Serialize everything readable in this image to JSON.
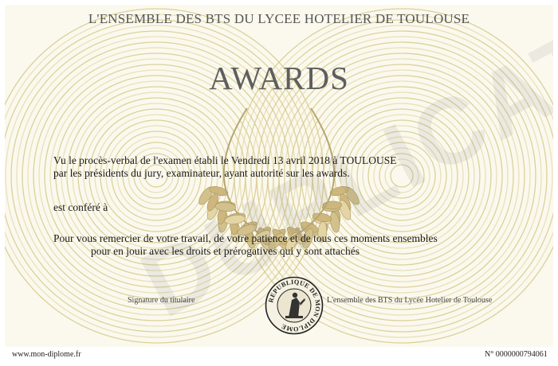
{
  "certificate": {
    "header": "L'ENSEMBLE DES BTS DU LYCEE HOTELIER DE TOULOUSE",
    "title": "AWARDS",
    "line1": "Vu le procès-verbal de l'examen établi le Vendredi 13 avril 2018  à TOULOUSE",
    "line2": "par les présidents du jury, examinateur, ayant autorité sur les awards.",
    "line3": "est conféré à",
    "line4": "Pour vous remercier de votre travail, de votre patience et de tous ces moments ensembles",
    "line5": "pour en jouir avec les droits et prérogatives qui y sont attachés",
    "signature_left": "Signature du titulaire",
    "signature_right": "L'ensemble des BTS du Lycée Hotelier de Toulouse",
    "seal_text": "REPUBLIQUE DE MON DIPLOME",
    "watermark": "DUPLICATA"
  },
  "footer": {
    "website": "www.mon-diplome.fr",
    "serial": "N° 0000000794061"
  },
  "colors": {
    "background": "#fbf9ee",
    "rings": "#d8cc8f",
    "laurel": "#cdbb86",
    "title": "#5e5e5e"
  }
}
